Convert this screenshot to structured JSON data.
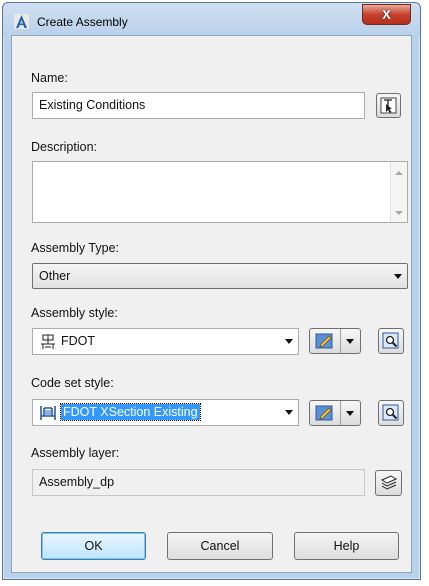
{
  "window": {
    "title": "Create Assembly",
    "close_label": "X"
  },
  "name": {
    "label": "Name:",
    "value": "Existing Conditions"
  },
  "description": {
    "label": "Description:",
    "value": ""
  },
  "assembly_type": {
    "label": "Assembly Type:",
    "value": "Other"
  },
  "assembly_style": {
    "label": "Assembly style:",
    "value": "FDOT"
  },
  "code_set_style": {
    "label": "Code set style:",
    "value": "FDOT XSection Existing"
  },
  "assembly_layer": {
    "label": "Assembly layer:",
    "value": "Assembly_dp"
  },
  "buttons": {
    "ok": "OK",
    "cancel": "Cancel",
    "help": "Help"
  },
  "colors": {
    "title_bar": "#b9d1ea",
    "close": "#c7402d",
    "selection": "#3399ff",
    "edit_icon": "#4a7cc4"
  }
}
